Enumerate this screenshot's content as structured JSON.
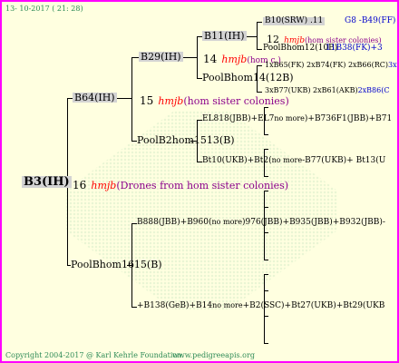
{
  "header": {
    "date": "13- 10-2017 ( 21: 28)"
  },
  "footer": {
    "copyright": "Copyright 2004-2017 @ Karl Kehrle Foundation.",
    "url": "www.pedigreeapis.org"
  },
  "root": {
    "label": "B3(IH)",
    "gen": "16",
    "hm": "hmjb",
    "desc": "(Drones from hom sister colonies)"
  },
  "b64": {
    "label": "B64(IH)",
    "gen": "15",
    "hm": "hmjb",
    "desc": "(hom sister colonies)"
  },
  "pbm16": {
    "label": "PoolBhom1615(B)"
  },
  "b29": {
    "label": "B29(IH)",
    "gen": "14",
    "hm": "hmjb",
    "desc": "(hom c.)"
  },
  "pbm15": {
    "label": "PoolB2hom1513(B)"
  },
  "b11": {
    "label": "B11(IH)"
  },
  "pbm14": {
    "label": "PoolBhom14(12B)"
  },
  "b10": {
    "label": "B10(SRW) .11",
    "code": "G8 -B49(FF)"
  },
  "g12": {
    "gen": "12",
    "hm": "hmjb",
    "desc": "(hom sister colonies)"
  },
  "pbm12": {
    "label": "PoolBhom12(10B)",
    "extra": "11B38(FK)+3"
  },
  "l1": {
    "a": "1xB65(FK) 2xB74(FK) 2xB66(RC)",
    "b": "3xB65(FK)C"
  },
  "l2": {
    "a": "3xB77(UKB) 2xB61(AKB)",
    "b": "2xB86(C"
  },
  "l3": {
    "a": "EL818(JBB)+EL7",
    "nm": "no more",
    "b": ")+B736F1(JBB)+B71"
  },
  "l4": {
    "a": "Bt10(UKB)+Bt2(",
    "nm": "no more",
    "b": "-B77(UKB)+ Bt13(U"
  },
  "l5": {
    "a": "B888(JBB)+B960(",
    "nm": "no more",
    "b": ")976(JBB)+B935(JBB)+B932(JBB)-"
  },
  "l6": {
    "a": "+B138(GeB)+B14",
    "nm": "no more",
    "b": "+B2(SSC)+Bt27(UKB)+Bt29(UKB"
  }
}
